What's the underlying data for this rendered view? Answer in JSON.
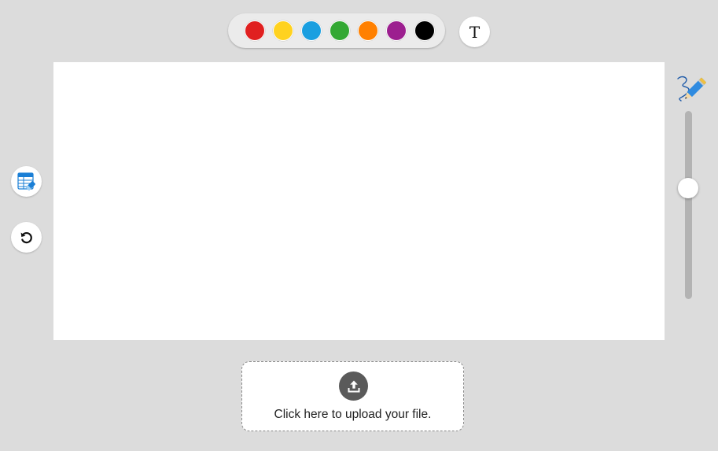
{
  "palette": {
    "colors": [
      {
        "name": "red",
        "hex": "#e02020"
      },
      {
        "name": "yellow",
        "hex": "#ffd21f"
      },
      {
        "name": "blue",
        "hex": "#1a9fe0"
      },
      {
        "name": "green",
        "hex": "#33a833"
      },
      {
        "name": "orange",
        "hex": "#ff8000"
      },
      {
        "name": "purple",
        "hex": "#9c1f8f"
      },
      {
        "name": "black",
        "hex": "#000000"
      }
    ]
  },
  "tools": {
    "text_label": "T",
    "text_icon": "text-tool-icon",
    "eraser_icon": "eraser-table-icon",
    "undo_icon": "undo-icon",
    "pencil_icon": "pencil-icon"
  },
  "brush_size": {
    "level": 0.4
  },
  "upload": {
    "label": "Click here to upload your file.",
    "icon": "upload-icon"
  }
}
